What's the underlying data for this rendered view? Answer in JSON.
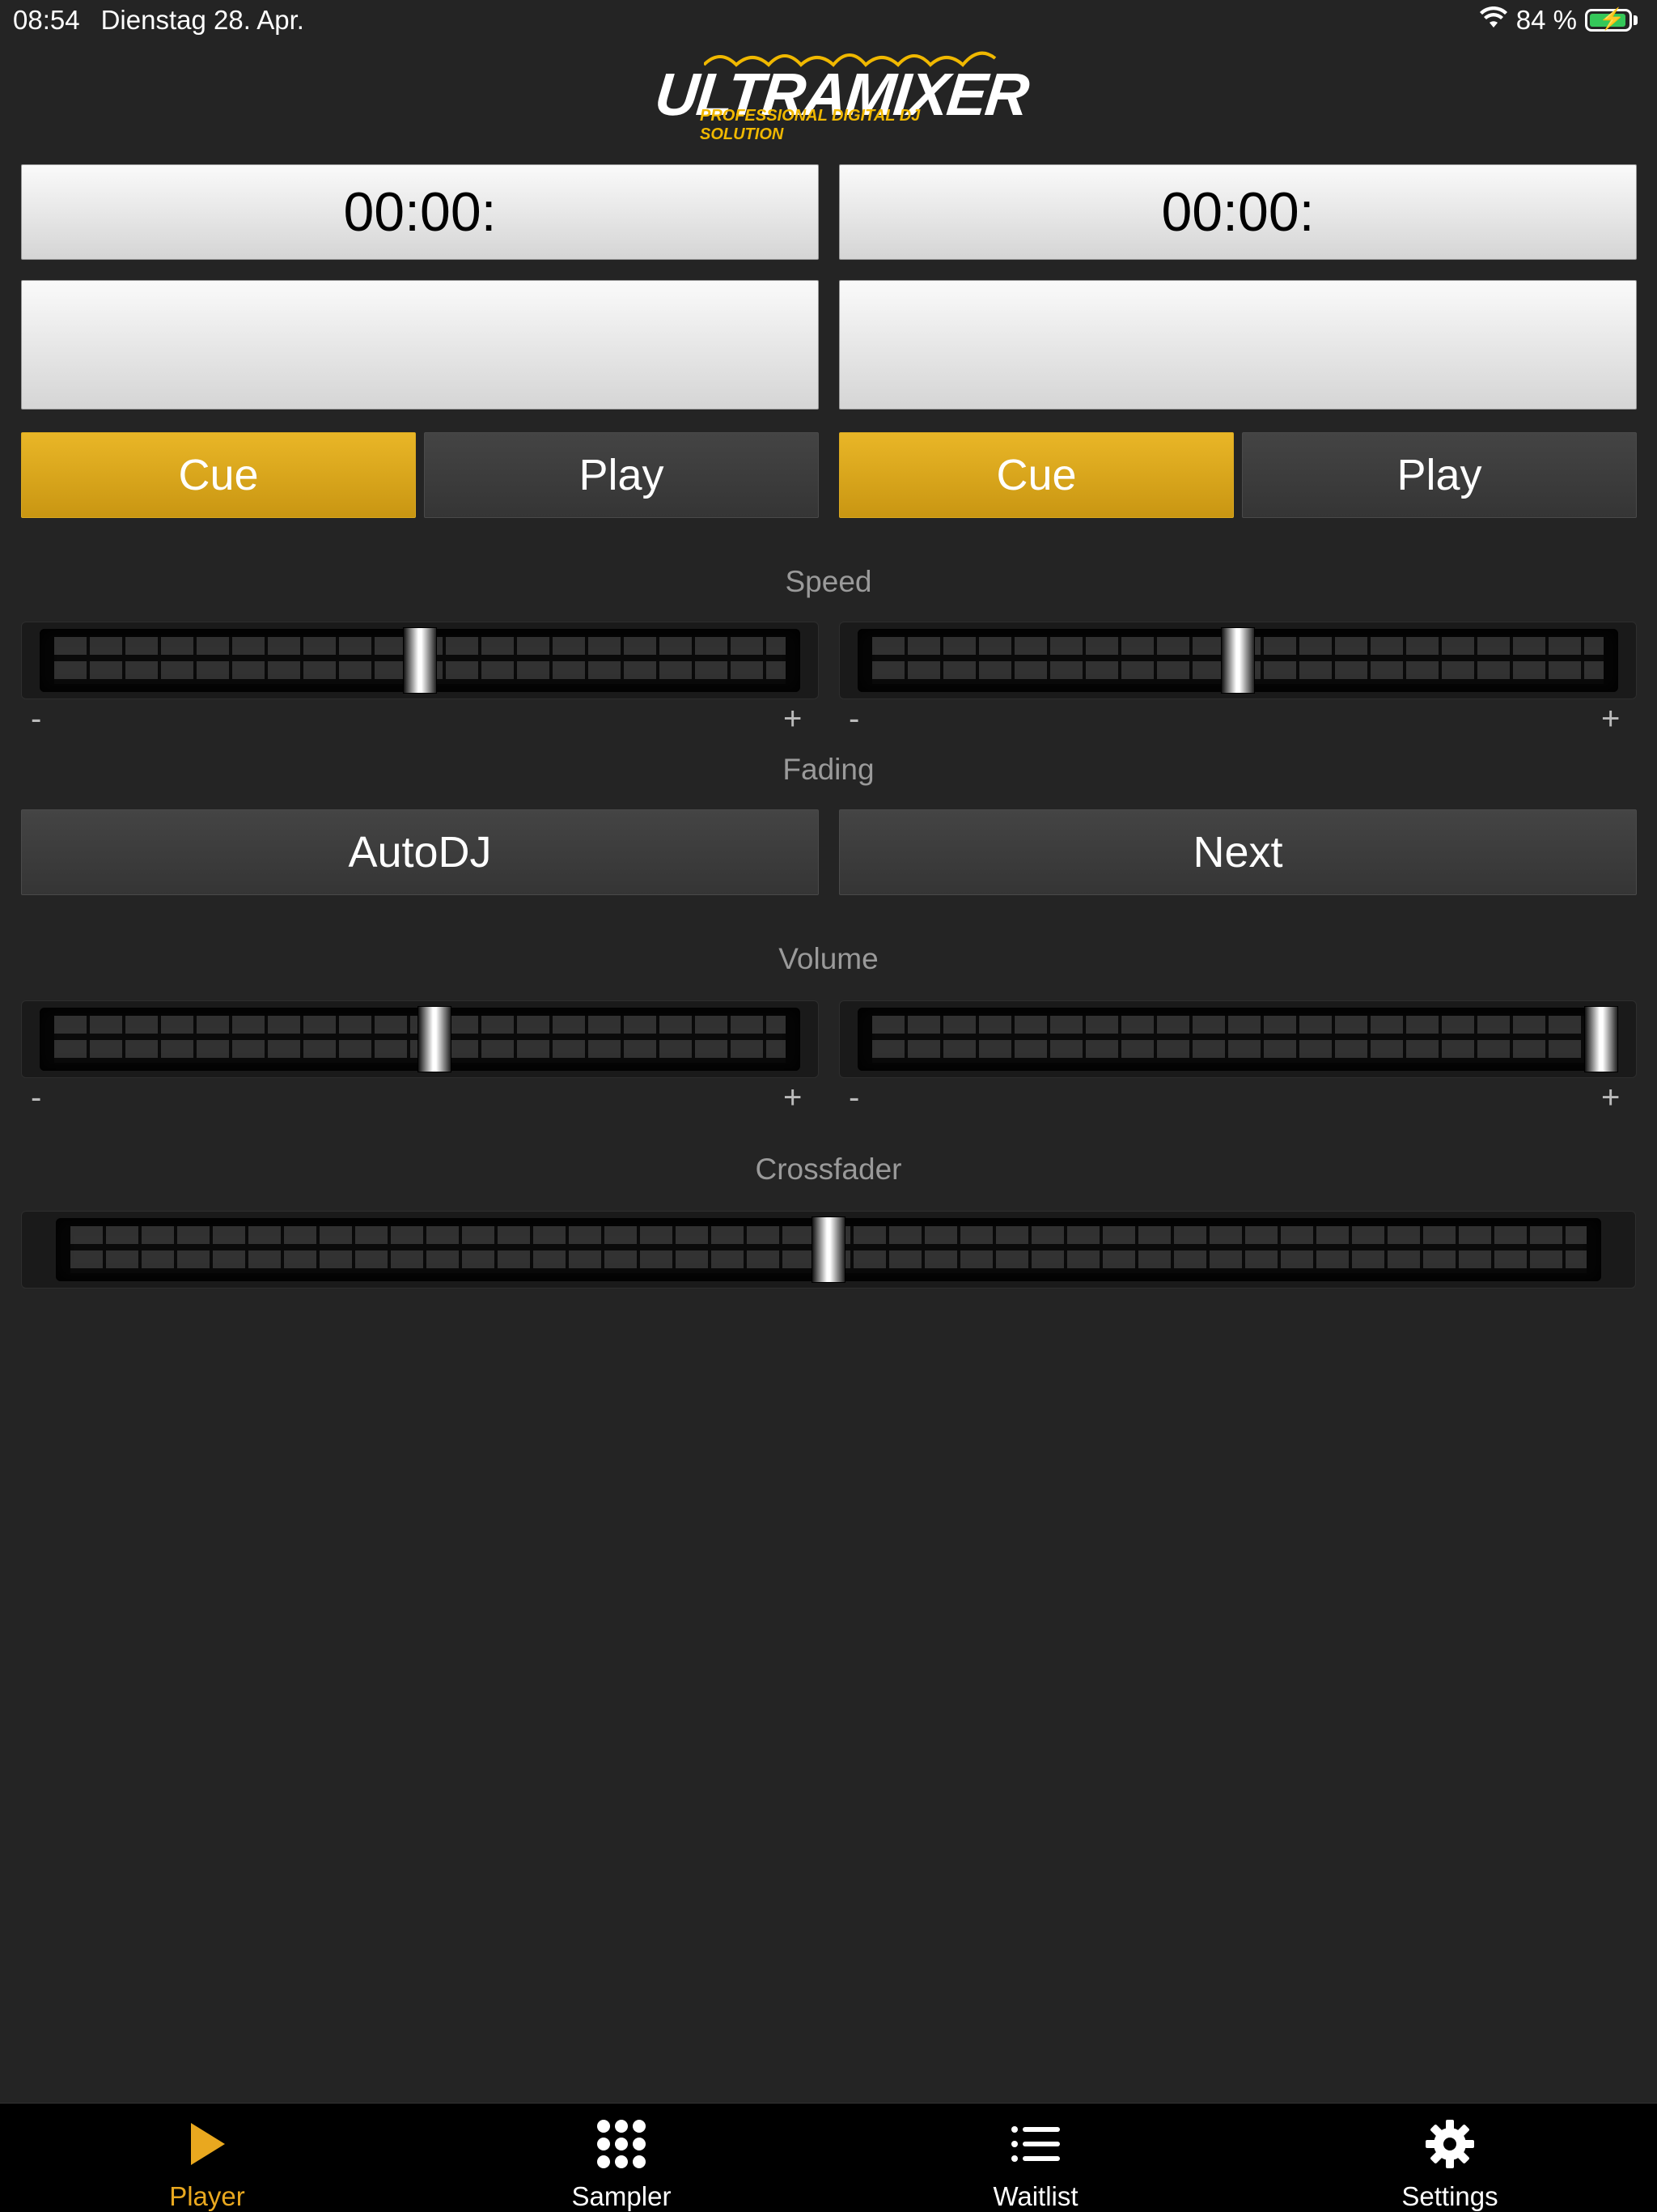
{
  "status_bar": {
    "time": "08:54",
    "date": "Dienstag 28. Apr.",
    "battery": "84 %"
  },
  "logo": {
    "name": "ULTRAMIXER",
    "tagline": "PROFESSIONAL DIGITAL DJ SOLUTION"
  },
  "decks": [
    {
      "time": "00:00:",
      "title": "",
      "cue_label": "Cue",
      "play_label": "Play",
      "speed_level": 0.5,
      "volume_level": 0.52
    },
    {
      "time": "00:00:",
      "title": "",
      "cue_label": "Cue",
      "play_label": "Play",
      "speed_level": 0.5,
      "volume_level": 1.0
    }
  ],
  "sections": {
    "speed": "Speed",
    "fading": "Fading",
    "volume": "Volume",
    "crossfader": "Crossfader"
  },
  "slider_marks": {
    "minus": "-",
    "plus": "+"
  },
  "fading": {
    "autodj_label": "AutoDJ",
    "next_label": "Next"
  },
  "crossfader": {
    "level": 0.5
  },
  "tabs": [
    {
      "label": "Player",
      "icon": "play-icon",
      "active": true
    },
    {
      "label": "Sampler",
      "icon": "grid-icon",
      "active": false
    },
    {
      "label": "Waitlist",
      "icon": "list-icon",
      "active": false
    },
    {
      "label": "Settings",
      "icon": "gear-icon",
      "active": false
    }
  ],
  "colors": {
    "accent": "#e9b627",
    "background": "#242424",
    "battery": "#35c759"
  }
}
